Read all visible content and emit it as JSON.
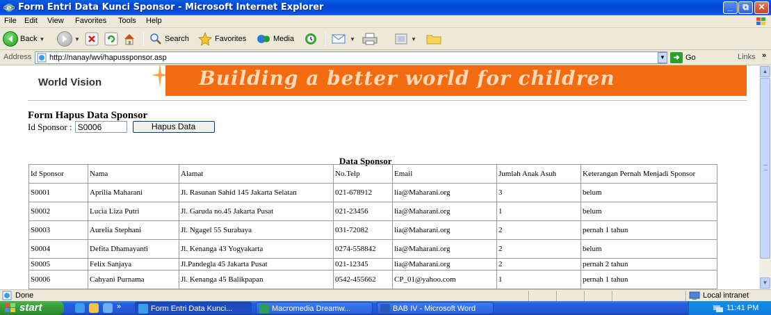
{
  "window": {
    "title": "Form Entri Data Kunci Sponsor - Microsoft Internet Explorer",
    "minimize": "_",
    "maximize": "⧉",
    "close": "✕"
  },
  "menu": [
    "File",
    "Edit",
    "View",
    "Favorites",
    "Tools",
    "Help"
  ],
  "toolbar": {
    "back": "Back",
    "search": "Search",
    "favorites": "Favorites",
    "media": "Media"
  },
  "address": {
    "label": "Address",
    "url": "http://nanay/wvi/hapussponsor.asp",
    "go": "Go",
    "links": "Links",
    "more": "»"
  },
  "banner": {
    "logo_text": "World Vision",
    "slogan": "Building a better world for children"
  },
  "form": {
    "title": "Form Hapus Data Sponsor",
    "id_label": "Id Sponsor :",
    "id_value": "S0006",
    "button": "Hapus Data"
  },
  "table": {
    "caption": "Data Sponsor",
    "headers": [
      "Id Sponsor",
      "Nama",
      "Alamat",
      "No.Telp",
      "Email",
      "Jumlah Anak Asuh",
      "Keterangan Pernah Menjadi Sponsor"
    ],
    "rows": [
      [
        "S0001",
        "Aprilia Maharani",
        "Jl. Rasunan Sahid 145 Jakarta Selatan",
        "021-678912",
        "lia@Maharani.org",
        "3",
        "belum"
      ],
      [
        "S0002",
        "Lucia Liza Putri",
        "Jl. Garuda no.45 Jakarta Pusat",
        "021-23456",
        "lia@Maharani.org",
        "1",
        "belum"
      ],
      [
        "S0003",
        "Aurelia Stephani",
        "Jl. Ngagel 55 Surabaya",
        "031-72082",
        "lia@Maharani.org",
        "2",
        "pernah 1 tahun"
      ],
      [
        "S0004",
        "Defita Dhamayanti",
        "Jl. Kenanga 43 Yogyakarta",
        "0274-558842",
        "lia@Maharani.org",
        "2",
        "belum"
      ],
      [
        "S0005",
        "Felix Sanjaya",
        "Jl.Pandegla 45 Jakarta Pusat",
        "021-12345",
        "lia@Maharani.org",
        "2",
        "pernah 2 tahun"
      ],
      [
        "S0006",
        "Cahyani Purnama",
        "Jl. Kenanga 45 Balikpapan",
        "0542-455662",
        "CP_01@yahoo.com",
        "1",
        "pernah 1 tahun"
      ]
    ]
  },
  "status": {
    "text": "Done",
    "zone": "Local intranet"
  },
  "taskbar": {
    "start": "start",
    "more": "»",
    "tasks": [
      "Form Entri Data Kunci...",
      "Macromedia Dreamw...",
      "BAB IV - Microsoft Word"
    ],
    "clock": "11:41 PM"
  },
  "colors": {
    "banner_orange": "#f26b10",
    "titlebar_blue": "#0046d5",
    "start_green": "#359a35"
  }
}
